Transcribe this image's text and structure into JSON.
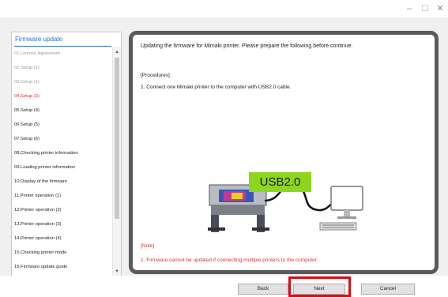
{
  "window": {
    "minimize_glyph": "–",
    "maximize_glyph": "☐",
    "close_glyph": "✕"
  },
  "sidebar": {
    "title": "Firmware update",
    "steps": [
      {
        "label": "01.License Agreement",
        "state": "done"
      },
      {
        "label": "02.Setup (1)",
        "state": "done"
      },
      {
        "label": "03.Setup (2)",
        "state": "done"
      },
      {
        "label": "04.Setup (3)",
        "state": "current"
      },
      {
        "label": "05.Setup (4)",
        "state": "pending"
      },
      {
        "label": "06.Setup (5)",
        "state": "pending"
      },
      {
        "label": "07.Setup (6)",
        "state": "pending"
      },
      {
        "label": "08.Checking printer information",
        "state": "pending"
      },
      {
        "label": "09.Loading printer information",
        "state": "pending"
      },
      {
        "label": "10.Display of the firmware",
        "state": "pending"
      },
      {
        "label": "11.Printer operation (1)",
        "state": "pending"
      },
      {
        "label": "12.Printer operation (2)",
        "state": "pending"
      },
      {
        "label": "13.Printer operation (3)",
        "state": "pending"
      },
      {
        "label": "14.Printer operation (4)",
        "state": "pending"
      },
      {
        "label": "15.Checking printer mode",
        "state": "pending"
      },
      {
        "label": "16.Firmware update guide",
        "state": "pending"
      }
    ],
    "scroll_up_glyph": "▲",
    "scroll_down_glyph": "▼"
  },
  "main": {
    "intro": "Updating the firmware for Mimaki printer. Please prepare the following before continue.",
    "procedures_heading": "[Procedures]",
    "procedure_item": "1.   Connect one Mimaki printer to the computer with USB2.0 cable.",
    "illustration_label": "USB2.0",
    "note_heading": "[Note]",
    "note_item": "1.   Firmware cannot be updated if connecting multiple printers to the computer."
  },
  "footer": {
    "back_label": "Back",
    "next_label": "Next",
    "cancel_label": "Cancel"
  },
  "colors": {
    "current_step": "#e03030",
    "done_step": "#9a9a9a",
    "sidebar_title": "#2a6fd6",
    "usb_label_bg": "#8ed61e",
    "highlight": "#e00b10",
    "panel_border": "#5a5a5a"
  }
}
